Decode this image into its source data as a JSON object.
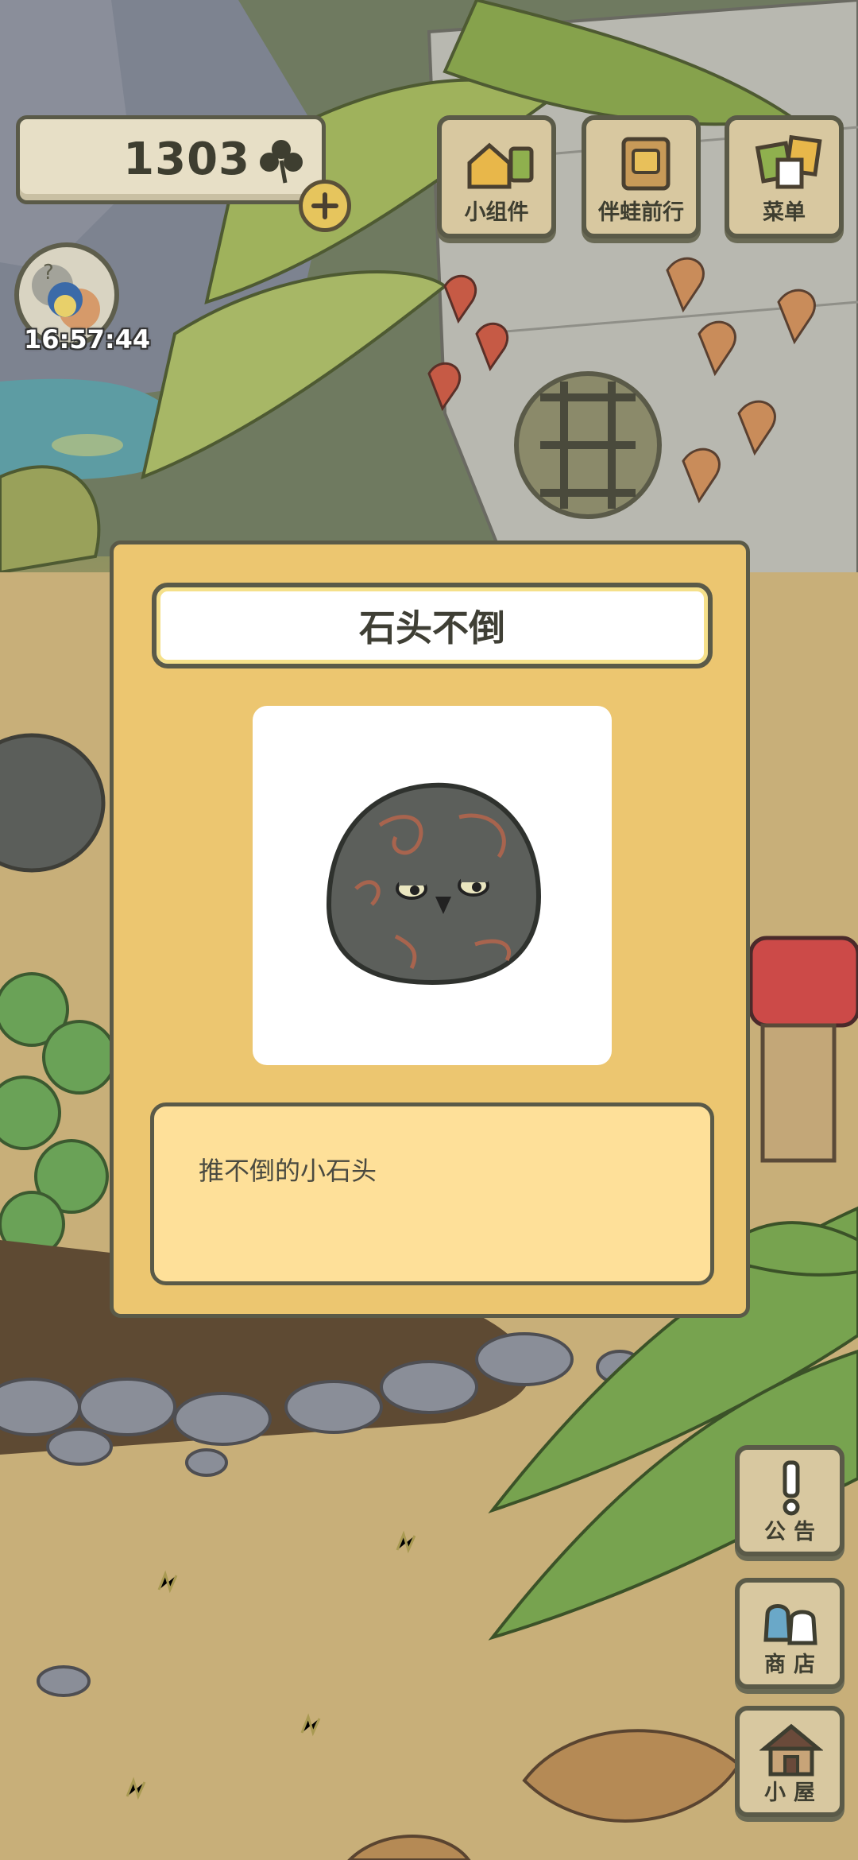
{
  "header": {
    "clover_count": "1303",
    "clover_icon": "clover-icon",
    "add_clover_icon": "plus-icon",
    "clock_time": "16:57:44"
  },
  "top_menu": [
    {
      "label": "小组件",
      "icon": "widget-icon"
    },
    {
      "label": "伴蛙前行",
      "icon": "frog-journey-icon"
    },
    {
      "label": "菜单",
      "icon": "menu-cards-icon"
    }
  ],
  "side_menu": [
    {
      "label": "公告",
      "icon": "exclamation-icon"
    },
    {
      "label": "商店",
      "icon": "shop-bags-icon"
    },
    {
      "label": "小屋",
      "icon": "house-icon"
    }
  ],
  "item_dialog": {
    "title": "石头不倒",
    "image": "stone-tumbler-icon",
    "description": "推不倒的小石头"
  },
  "colors": {
    "dialog_bg": "#ecc670",
    "desc_bg": "#fee099",
    "border": "#5a5a48",
    "button_bg": "#d8c8a0"
  }
}
